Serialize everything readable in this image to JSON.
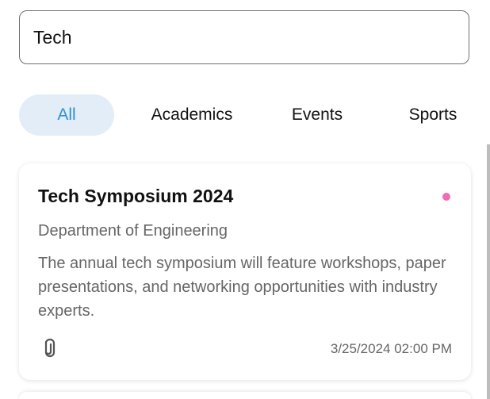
{
  "search": {
    "value": "Tech",
    "placeholder": ""
  },
  "tabs": [
    {
      "label": "All",
      "active": true
    },
    {
      "label": "Academics",
      "active": false
    },
    {
      "label": "Events",
      "active": false
    },
    {
      "label": "Sports",
      "active": false
    }
  ],
  "announcements": [
    {
      "title": "Tech Symposium 2024",
      "department": "Department of Engineering",
      "description": "The annual tech symposium will feature workshops, paper presentations, and networking opportunities with industry experts.",
      "timestamp": "3/25/2024 02:00 PM",
      "unread": true,
      "has_attachment": true,
      "attachment_icon": "paperclip-icon"
    }
  ],
  "colors": {
    "accent": "#2f8fd3",
    "active_tab_bg": "#e2edf8",
    "unread_dot": "#f46ab5",
    "muted_text": "#666666",
    "icon": "#555555"
  }
}
